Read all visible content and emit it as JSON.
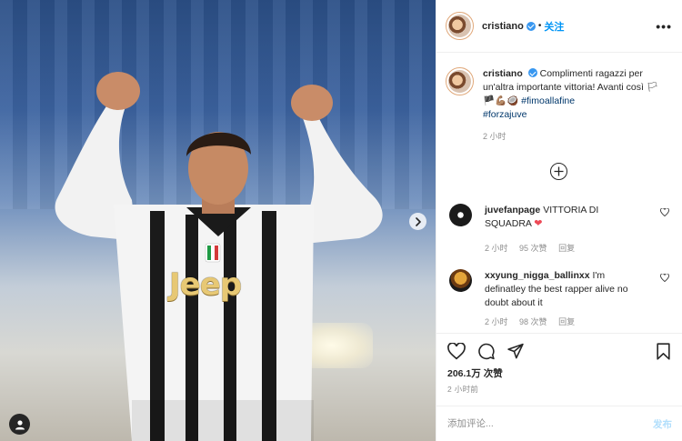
{
  "header": {
    "username": "cristiano",
    "separator": "•",
    "follow_label": "关注",
    "more_label": "•••"
  },
  "caption": {
    "username": "cristiano",
    "text_main": "Complimenti ragazzi per un'altra importante vittoria! Avanti così 🏳🏴💪🏽🥥",
    "hashtag1": "#fimoallafine",
    "hashtag2": "#forzajuve",
    "age": "2 小时"
  },
  "comments": [
    {
      "username": "juvefanpage",
      "text": "VITTORIA DI SQUADRA",
      "emoji": "❤",
      "age": "2 小时",
      "likes": "95 次赞",
      "reply": "回复"
    },
    {
      "username": "xxyung_nigga_ballinxx",
      "text": "I'm definatley the best rapper alive no doubt about it",
      "age": "2 小时",
      "likes": "98 次赞",
      "reply": "回复"
    }
  ],
  "likes_count": "206.1万 次赞",
  "timestamp": "2 小时前",
  "comment_input": {
    "placeholder": "添加评论...",
    "post_label": "发布"
  },
  "photo": {
    "jersey_text": "Jeep"
  },
  "colors": {
    "link_blue": "#0095f6",
    "verified_blue": "#3897f0",
    "hashtag": "#00376b",
    "muted": "#8e8e8e",
    "border": "#efefef",
    "post_disabled": "#b2dffc"
  },
  "icons": {
    "heart": "heart-icon",
    "comment": "comment-icon",
    "share": "paper-plane-icon",
    "save": "bookmark-icon",
    "add": "plus-circle-icon",
    "next": "chevron-right-icon",
    "user_tag": "user-icon"
  }
}
